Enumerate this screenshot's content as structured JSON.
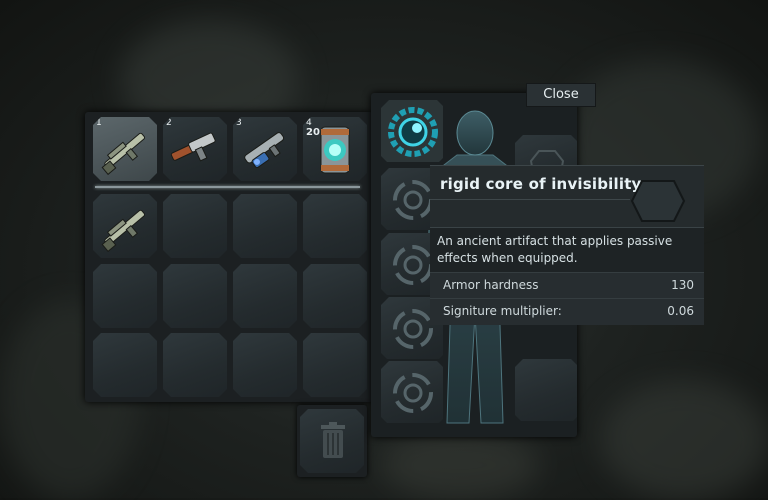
{
  "inventory": {
    "slots": [
      {
        "number": "1",
        "count": "",
        "item": "rifle-icon"
      },
      {
        "number": "2",
        "count": "",
        "item": "shotgun-icon"
      },
      {
        "number": "3",
        "count": "",
        "item": "plasma-gun-icon"
      },
      {
        "number": "4",
        "count": "20",
        "item": "energy-cell-icon"
      }
    ],
    "backpack_items": [
      "rifle-icon"
    ]
  },
  "close_button": "Close",
  "tooltip": {
    "title": "rigid core of invisibility",
    "description": "An ancient artifact that applies passive effects when equipped.",
    "stats": [
      {
        "label": "Armor hardness",
        "value": "130"
      },
      {
        "label": "Signiture multiplier:",
        "value": "0.06"
      }
    ]
  },
  "colors": {
    "accent": "#3fd3e6",
    "panel": "#1c2022",
    "slot": "#2a3235"
  }
}
